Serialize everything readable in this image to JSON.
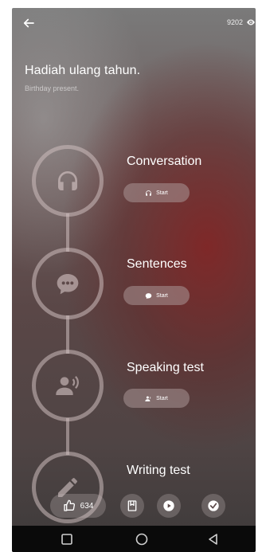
{
  "header": {
    "view_count": "9202",
    "title": "Hadiah ulang tahun.",
    "subtitle": "Birthday present."
  },
  "sections": [
    {
      "label": "Conversation",
      "button_label": "Start",
      "icon": "headphones-icon"
    },
    {
      "label": "Sentences",
      "button_label": "Start",
      "icon": "chat-bubble-icon"
    },
    {
      "label": "Speaking test",
      "button_label": "Start",
      "icon": "speaking-person-icon"
    },
    {
      "label": "Writing test",
      "icon": "pencil-icon"
    }
  ],
  "bottom_bar": {
    "like_count": "634",
    "icons": [
      "thumbs-up-icon",
      "bookmark-icon",
      "play-icon",
      "check-icon"
    ]
  },
  "nav_bar": {
    "icons": [
      "recents-square-icon",
      "home-circle-icon",
      "back-triangle-icon"
    ]
  },
  "colors": {
    "accent_track": "#cdbebe",
    "background_red": "#802626",
    "nav_bar": "#0a0a0a"
  }
}
